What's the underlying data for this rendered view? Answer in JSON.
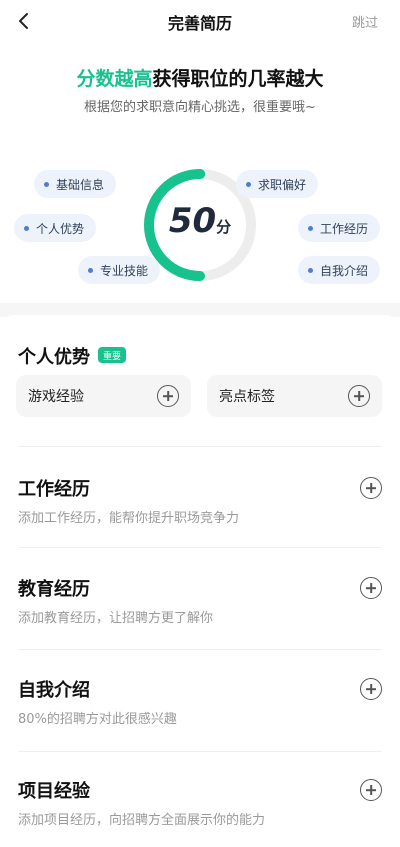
{
  "nav": {
    "title": "完善简历",
    "skip_label": "跳过"
  },
  "header": {
    "headline_highlight": "分数越高",
    "headline_rest": "获得职位的几率越大",
    "subline": "根据您的求职意向精心挑选，很重要哦~"
  },
  "score": {
    "value": "50",
    "unit": "分",
    "progress": 0.5
  },
  "chips": {
    "basic_info": "基础信息",
    "personal_advantage": "个人优势",
    "professional_skills": "专业技能",
    "job_preference": "求职偏好",
    "work_experience": "工作经历",
    "self_intro": "自我介绍"
  },
  "sections": {
    "advantage": {
      "title": "个人优势",
      "badge": "重要",
      "options": [
        "游戏经验",
        "亮点标签"
      ]
    },
    "work": {
      "title": "工作经历",
      "desc": "添加工作经历，能帮你提升职场竞争力"
    },
    "education": {
      "title": "教育经历",
      "desc": "添加教育经历，让招聘方更了解你"
    },
    "self_intro": {
      "title": "自我介绍",
      "desc": "80%的招聘方对此很感兴趣"
    },
    "projects": {
      "title": "项目经验",
      "desc": "添加项目经历，向招聘方全面展示你的能力"
    }
  },
  "colors": {
    "accent": "#18c28f",
    "ring_track": "#ededed",
    "chip_bg": "#eef3fb"
  }
}
